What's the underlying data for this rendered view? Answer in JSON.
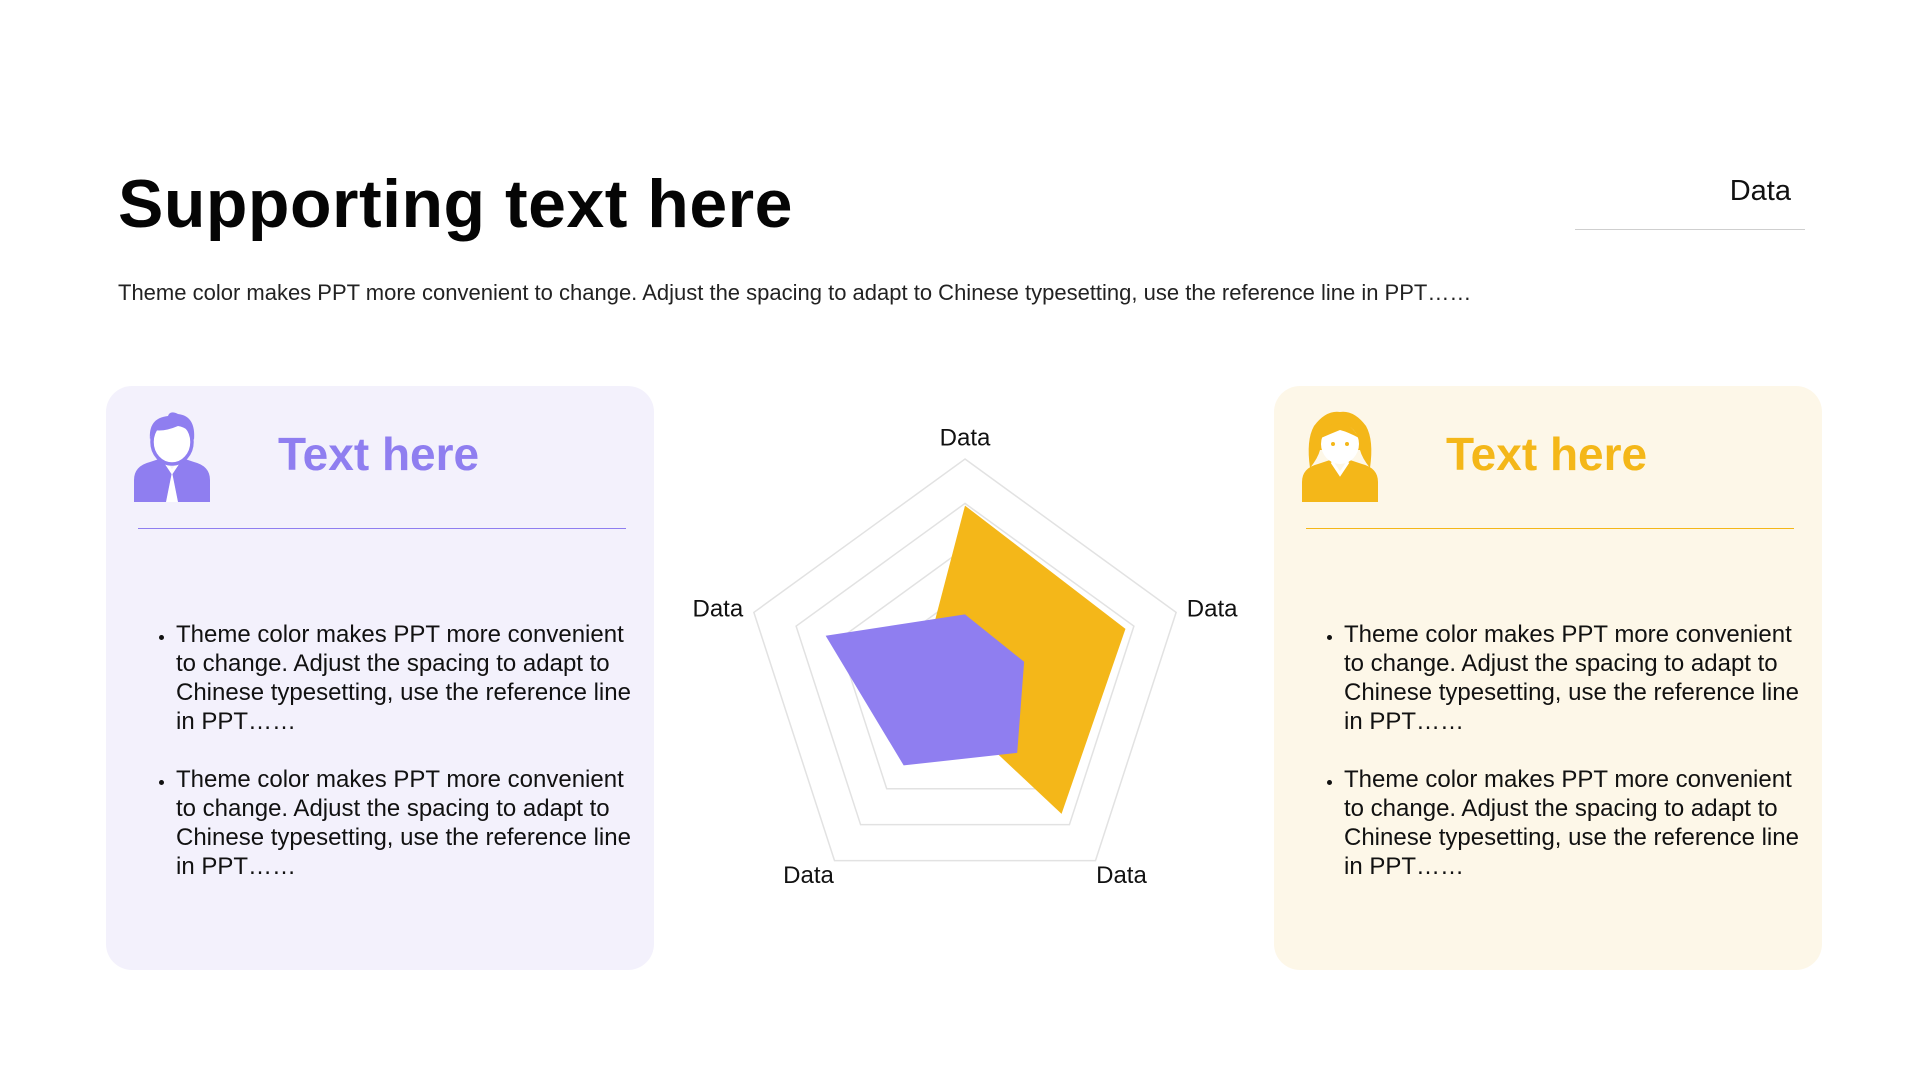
{
  "header": {
    "title": "Supporting text here",
    "subtitle": "Theme color makes PPT more convenient to change. Adjust the spacing to adapt to Chinese typesetting, use the reference line in PPT……",
    "top_right_label": "Data"
  },
  "left_card": {
    "icon": "male-user-icon",
    "title": "Text here",
    "accent": "#8f7ef0",
    "background": "#f3f1fc",
    "bullets": [
      "Theme color makes PPT more convenient to change. Adjust the spacing to adapt to Chinese typesetting, use the reference line in PPT……",
      "Theme color makes PPT more convenient to change. Adjust the spacing to adapt to Chinese typesetting, use the reference line in PPT……"
    ]
  },
  "right_card": {
    "icon": "female-user-icon",
    "title": "Text here",
    "accent": "#f4b719",
    "background": "#fdf7e8",
    "bullets": [
      "Theme color makes PPT more convenient to change. Adjust the spacing to adapt to Chinese typesetting, use the reference line in PPT……",
      "Theme color makes PPT more convenient to change. Adjust the spacing to adapt to Chinese typesetting, use the reference line in PPT……"
    ]
  },
  "chart_data": {
    "type": "radar",
    "categories": [
      "Data",
      "Data",
      "Data",
      "Data",
      "Data"
    ],
    "rlim": [
      0,
      5
    ],
    "grid_levels": 5,
    "grid": true,
    "series": [
      {
        "color": "#f4b719",
        "values": [
          3.95,
          3.8,
          3.7,
          0.7,
          1.0
        ]
      },
      {
        "color": "#8f7ef0",
        "values": [
          1.5,
          1.4,
          2.0,
          2.35,
          3.3
        ]
      }
    ]
  }
}
